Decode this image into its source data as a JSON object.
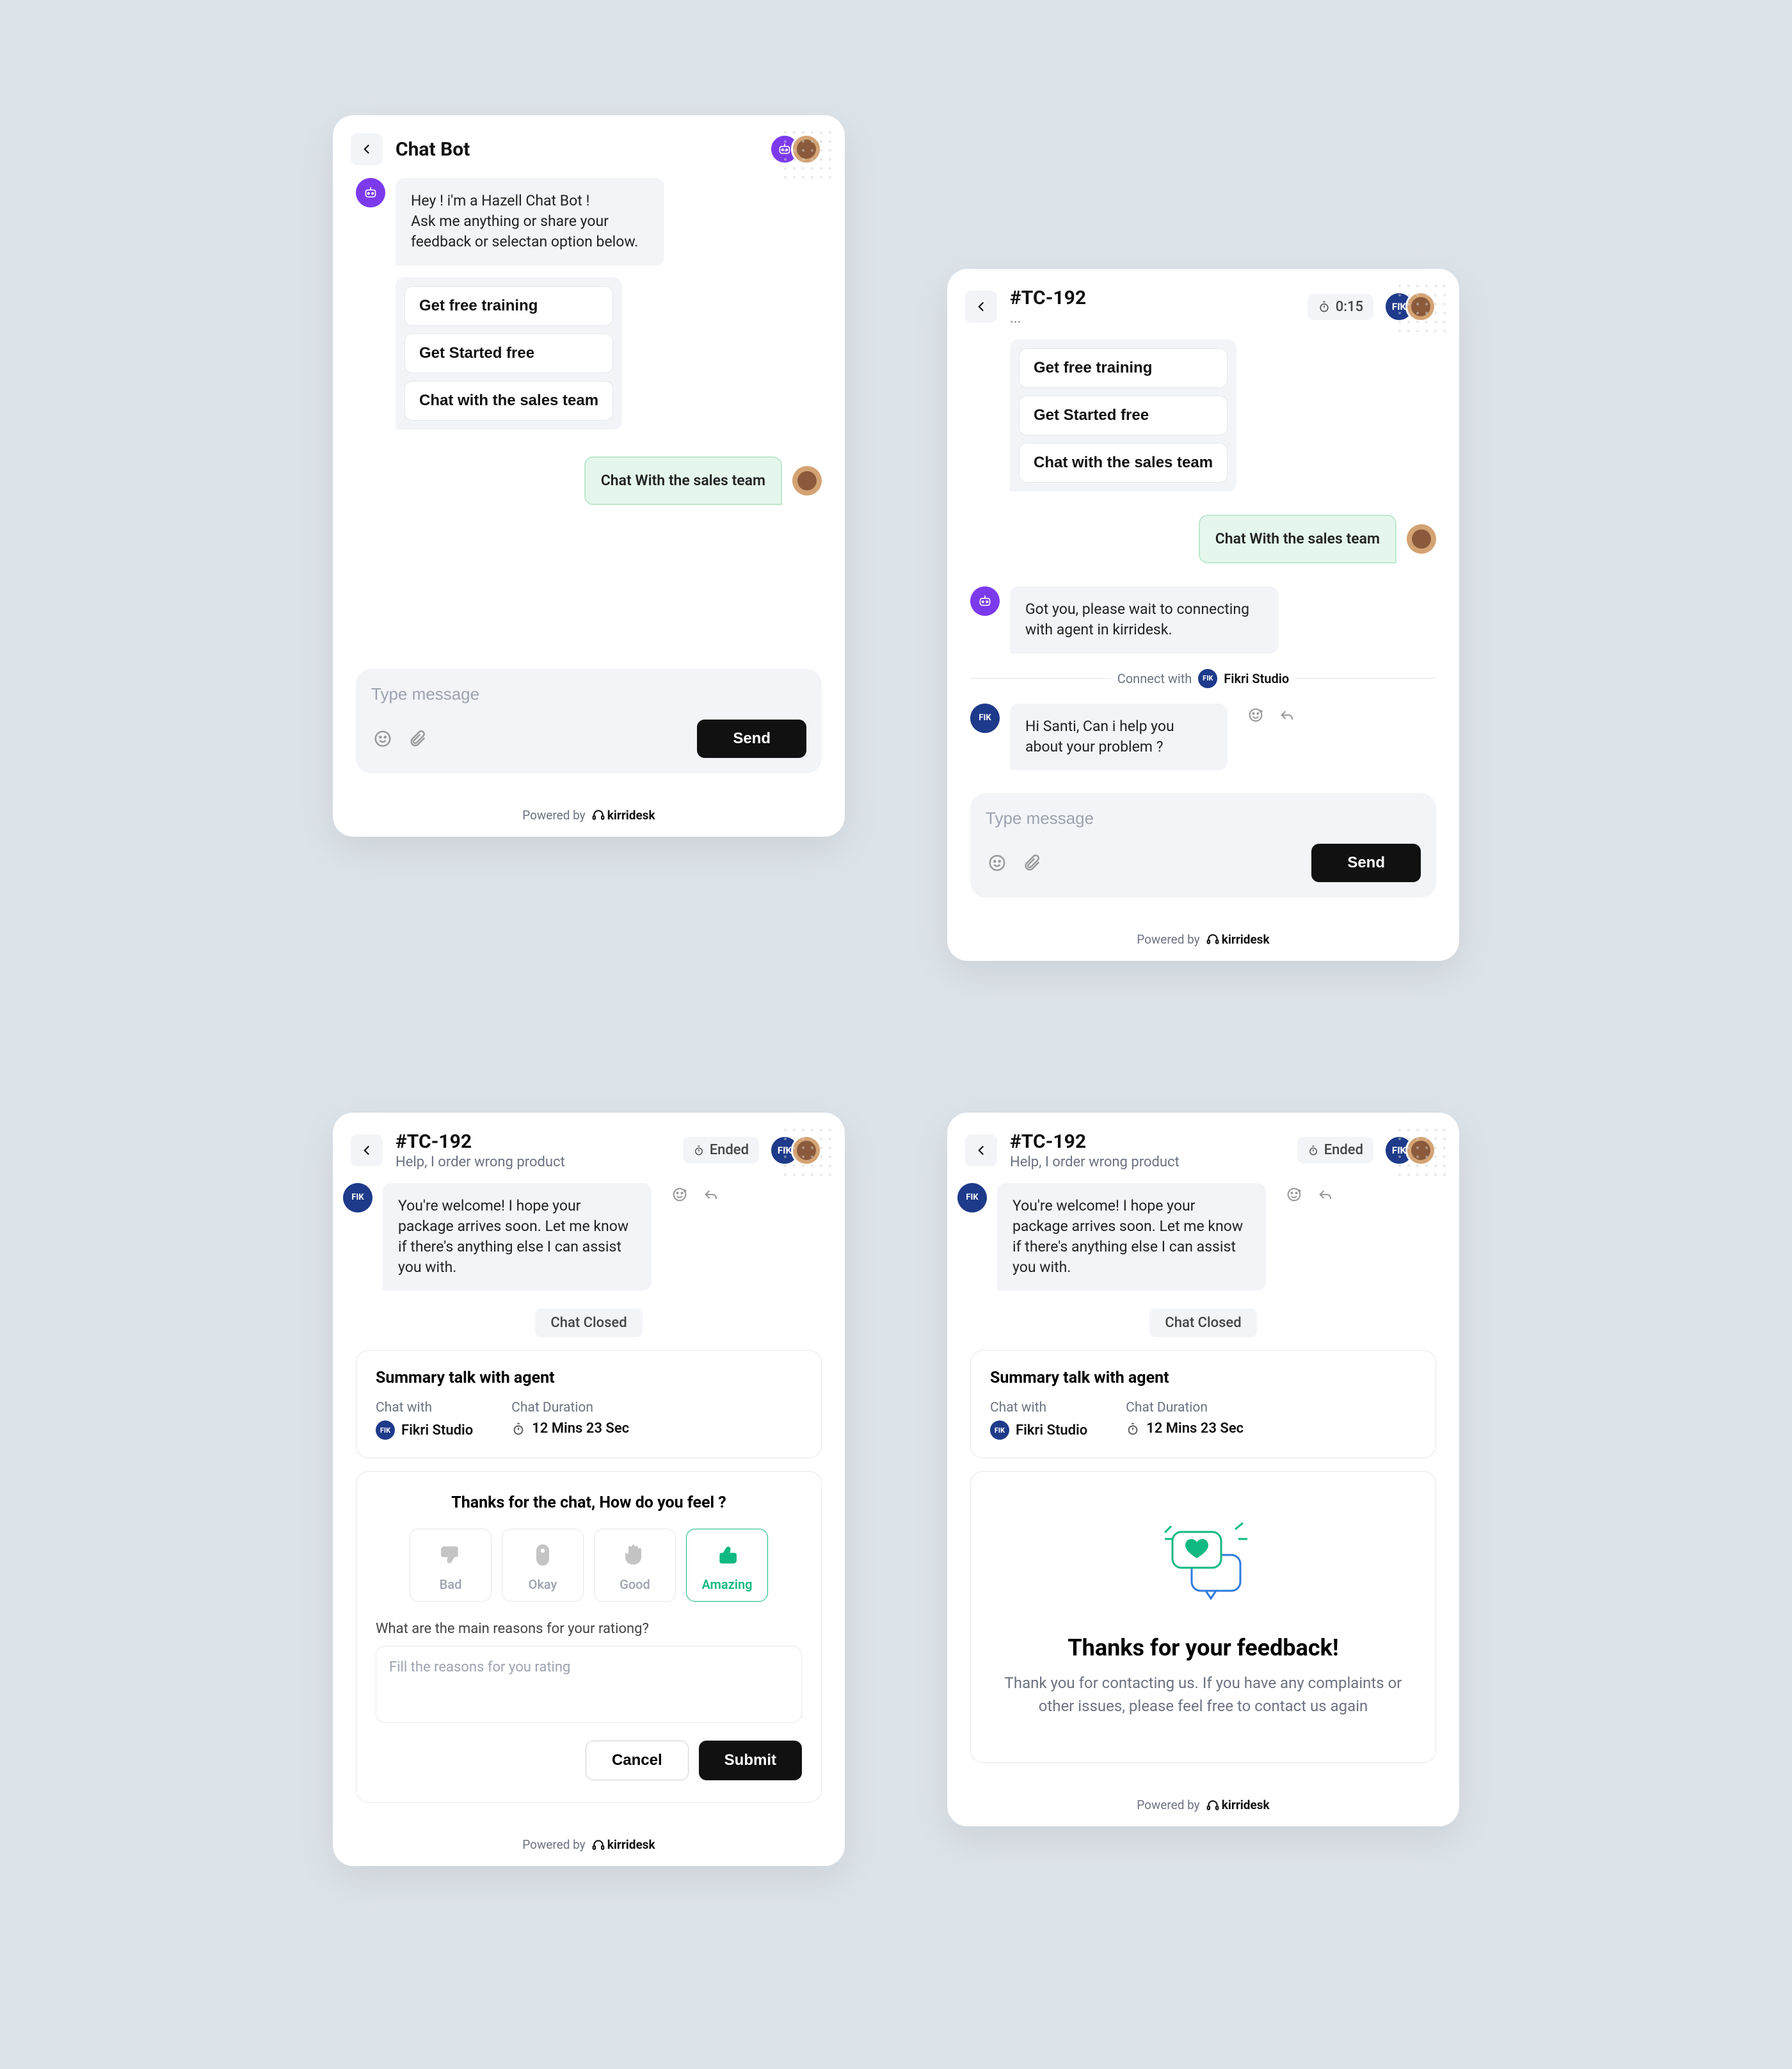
{
  "common": {
    "powered_by": "Powered by",
    "brand": "kirridesk",
    "send_label": "Send",
    "placeholder": "Type message"
  },
  "widget1": {
    "title": "Chat Bot",
    "bot_intro_line1": "Hey ! i'm a Hazell Chat Bot !",
    "bot_intro_line2": "Ask me anything or share your feedback or selectan option below.",
    "options": {
      "a": "Get free training",
      "b": "Get Started free",
      "c": "Chat with the sales team"
    },
    "user_msg": "Chat With the sales team"
  },
  "widget2": {
    "title": "#TC-192",
    "subtitle": "...",
    "time": "0:15",
    "options": {
      "a": "Get free training",
      "b": "Get Started free",
      "c": "Chat with the sales team"
    },
    "user_msg": "Chat With the sales team",
    "bot_msg": "Got you, please wait to connecting with agent in kirridesk.",
    "connect_with": "Connect with",
    "agent_name": "Fikri Studio",
    "agent_msg": "Hi Santi, Can i help you about your problem ?"
  },
  "widget3": {
    "title": "#TC-192",
    "subtitle": "Help, I order wrong product",
    "ended": "Ended",
    "agent_msg": "You're welcome! I hope your package arrives soon. Let me know if there's anything else I can assist you with.",
    "chat_closed": "Chat Closed",
    "summary_title": "Summary talk with agent",
    "chat_with_lbl": "Chat with",
    "agent_name": "Fikri Studio",
    "duration_lbl": "Chat Duration",
    "duration_val": "12 Mins 23 Sec",
    "feedback_q": "Thanks for the chat, How do you feel ?",
    "ratings": {
      "a": "Bad",
      "b": "Okay",
      "c": "Good",
      "d": "Amazing"
    },
    "reasons_q": "What are the main reasons for your rationg?",
    "reasons_ph": "Fill the reasons for you rating",
    "cancel": "Cancel",
    "submit": "Submit"
  },
  "widget4": {
    "title": "#TC-192",
    "subtitle": "Help, I order wrong product",
    "ended": "Ended",
    "agent_msg": "You're welcome! I hope your package arrives soon. Let me know if there's anything else I can assist you with.",
    "chat_closed": "Chat Closed",
    "summary_title": "Summary talk with agent",
    "chat_with_lbl": "Chat with",
    "agent_name": "Fikri Studio",
    "duration_lbl": "Chat Duration",
    "duration_val": "12 Mins 23 Sec",
    "thank_title": "Thanks for your feedback!",
    "thank_body": "Thank you for contacting us. If you have any complaints or other issues, please feel free to contact us again"
  }
}
